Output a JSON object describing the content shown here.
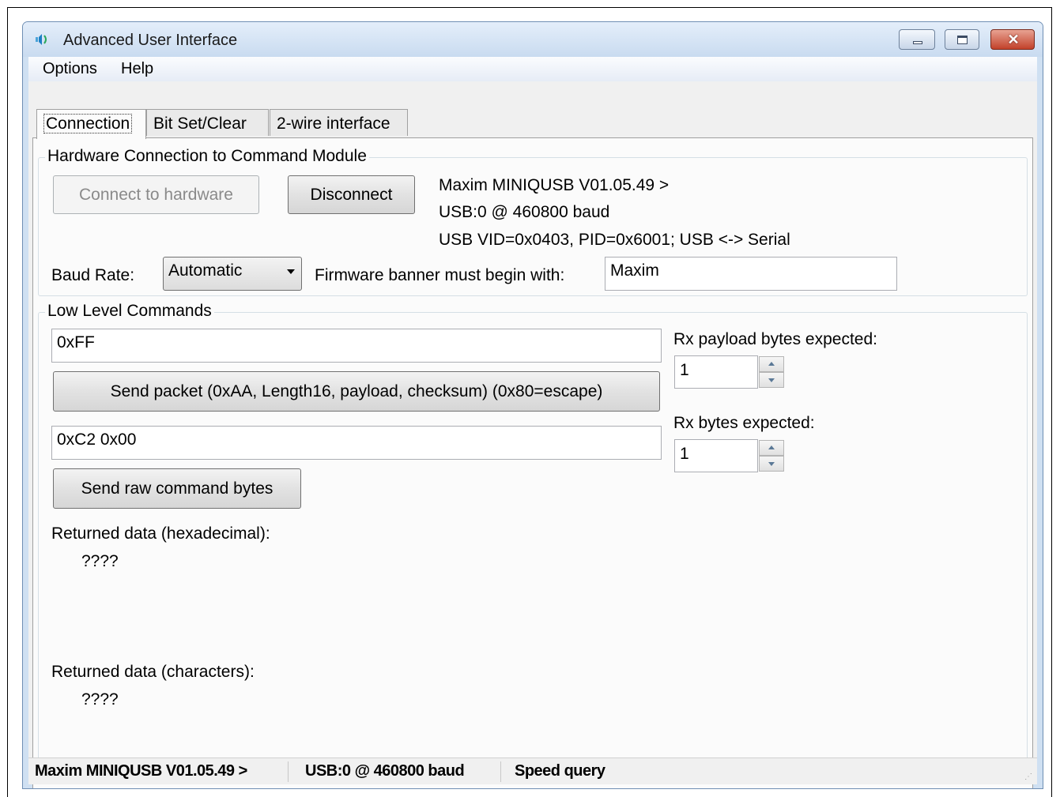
{
  "window": {
    "title": "Advanced User Interface"
  },
  "menu": {
    "items": [
      "Options",
      "Help"
    ]
  },
  "tabs": [
    "Connection",
    "Bit Set/Clear",
    "2-wire interface"
  ],
  "hardware": {
    "group_title": "Hardware Connection to Command Module",
    "connect_label": "Connect to hardware",
    "disconnect_label": "Disconnect",
    "info_lines": [
      "Maxim MINIQUSB V01.05.49 >",
      "USB:0 @ 460800 baud",
      "USB VID=0x0403, PID=0x6001; USB <-> Serial"
    ],
    "baud_label": "Baud Rate:",
    "baud_value": "Automatic",
    "banner_label": "Firmware banner must begin with:",
    "banner_value": "Maxim"
  },
  "lowlevel": {
    "group_title": "Low Level Commands",
    "packet_input": "0xFF",
    "send_packet_label": "Send packet (0xAA, Length16, payload, checksum)  (0x80=escape)",
    "raw_input": "0xC2 0x00",
    "send_raw_label": "Send raw command bytes",
    "rx_payload_label": "Rx payload bytes expected:",
    "rx_payload_value": "1",
    "rx_bytes_label": "Rx bytes expected:",
    "rx_bytes_value": "1",
    "returned_hex_label": "Returned data (hexadecimal):",
    "returned_hex_value": "????",
    "returned_chars_label": "Returned data (characters):",
    "returned_chars_value": "????"
  },
  "status": {
    "items": [
      "Maxim MINIQUSB V01.05.49 >",
      "USB:0 @ 460800 baud",
      "Speed query"
    ]
  }
}
